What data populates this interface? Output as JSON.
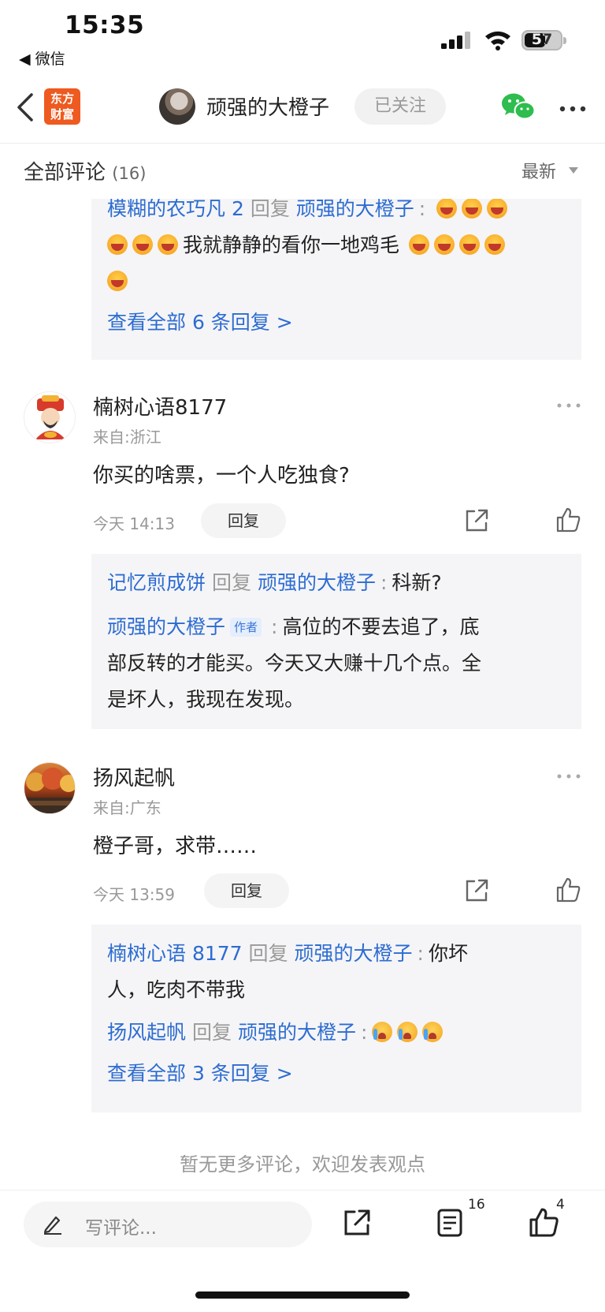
{
  "status_bar": {
    "time": "15:35",
    "back_app": "◀ 微信",
    "battery": "57"
  },
  "nav": {
    "logo_line1": "东方",
    "logo_line2": "财富",
    "author": "顽强的大橙子",
    "follow_label": "已关注"
  },
  "section": {
    "title": "全部评论",
    "count": "(16)",
    "sort": "最新"
  },
  "top_reply_box": {
    "user": "模糊的农巧凡 2",
    "reply_word": "回复",
    "target": "顽强的大橙子",
    "colon": ":",
    "text": "我就静静的看你一地鸡毛",
    "view_all": "查看全部 6 条回复 >"
  },
  "comments": [
    {
      "name": "楠树心语8177",
      "location": "来自:浙江",
      "text": "你买的啥票，一个人吃独食?",
      "time": "今天 14:13",
      "reply_label": "回复",
      "replies": [
        {
          "user": "记忆煎成饼",
          "reply_word": "回复",
          "target": "顽强的大橙子",
          "text": "科新?"
        },
        {
          "user": "顽强的大橙子",
          "tag": "作者",
          "line1": "高位的不要去追了，底",
          "line2": "部反转的才能买。今天又大赚十几个点。全",
          "line3": "是坏人，我现在发现。"
        }
      ]
    },
    {
      "name": "扬风起帆",
      "location": "来自:广东",
      "text": "橙子哥，求带……",
      "time": "今天 13:59",
      "reply_label": "回复",
      "replies": [
        {
          "user": "楠树心语 8177",
          "reply_word": "回复",
          "target": "顽强的大橙子",
          "line1": "你坏",
          "line2": "人，吃肉不带我"
        },
        {
          "user": "扬风起帆",
          "reply_word": "回复",
          "target": "顽强的大橙子"
        }
      ],
      "view_all": "查看全部 3 条回复 >"
    }
  ],
  "footer_note": "暂无更多评论，欢迎发表观点",
  "bottom_bar": {
    "input_placeholder": "写评论...",
    "comment_count": "16",
    "like_count": "4"
  }
}
